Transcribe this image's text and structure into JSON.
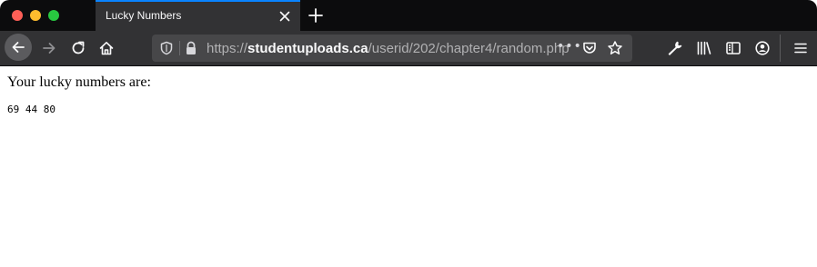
{
  "tab": {
    "title": "Lucky Numbers"
  },
  "urlbar": {
    "scheme": "https://",
    "host": "studentuploads.ca",
    "path": "/userid/202/chapter4/random.php",
    "more_actions": "•••"
  },
  "page": {
    "heading": "Your lucky numbers are:",
    "numbers": "69 44 80"
  },
  "icons": {
    "back": "arrow-left-icon",
    "forward": "arrow-right-icon",
    "reload": "reload-icon",
    "home": "home-icon",
    "shield": "tracking-shield-icon",
    "lock": "lock-icon",
    "pocket": "pocket-icon",
    "bookmark": "star-icon",
    "tools": "wrench-icon",
    "library": "library-icon",
    "sidebar": "sidebar-icon",
    "account": "account-icon",
    "menu": "hamburger-menu-icon"
  },
  "colors": {
    "accent": "#0a84ff",
    "toolbar": "#323234",
    "urlbar": "#474749"
  }
}
